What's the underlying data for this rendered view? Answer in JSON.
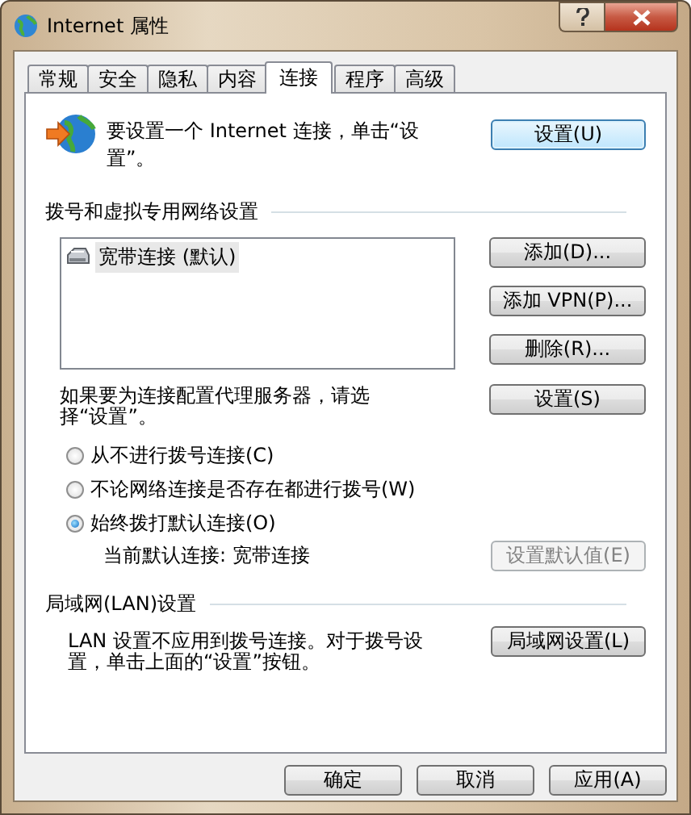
{
  "window": {
    "title": "Internet 属性"
  },
  "tabs": [
    {
      "label": "常规",
      "selected": false
    },
    {
      "label": "安全",
      "selected": false
    },
    {
      "label": "隐私",
      "selected": false
    },
    {
      "label": "内容",
      "selected": false
    },
    {
      "label": "连接",
      "selected": true
    },
    {
      "label": "程序",
      "selected": false
    },
    {
      "label": "高级",
      "selected": false
    }
  ],
  "setup": {
    "text": "要设置一个 Internet 连接，单击“设置”。",
    "button": {
      "label": "设置(U)",
      "disabled": false
    }
  },
  "dialup": {
    "heading": "拨号和虚拟专用网络设置",
    "connections": [
      {
        "name": "宽带连接 (默认)",
        "selected": true
      }
    ],
    "buttons": [
      {
        "label": "添加(D)...",
        "disabled": false
      },
      {
        "label": "添加 VPN(P)...",
        "disabled": false
      },
      {
        "label": "删除(R)...",
        "disabled": false
      }
    ]
  },
  "proxy": {
    "text": "如果要为连接配置代理服务器，请选择“设置”。",
    "button": {
      "label": "设置(S)",
      "disabled": false
    }
  },
  "dial_options": [
    {
      "label": "从不进行拨号连接(C)",
      "selected": false
    },
    {
      "label": "不论网络连接是否存在都进行拨号(W)",
      "selected": false
    },
    {
      "label": "始终拨打默认连接(O)",
      "selected": true
    }
  ],
  "current_default": {
    "label": "当前默认连接:",
    "value": "宽带连接",
    "button": {
      "label": "设置默认值(E)",
      "disabled": true
    }
  },
  "lan": {
    "heading": "局域网(LAN)设置",
    "text": "LAN 设置不应用到拨号连接。对于拨号设置，单击上面的“设置”按钮。",
    "button": {
      "label": "局域网设置(L)",
      "disabled": false
    }
  },
  "footer_buttons": [
    {
      "label": "确定",
      "disabled": false
    },
    {
      "label": "取消",
      "disabled": false
    },
    {
      "label": "应用(A)",
      "disabled": false
    }
  ]
}
